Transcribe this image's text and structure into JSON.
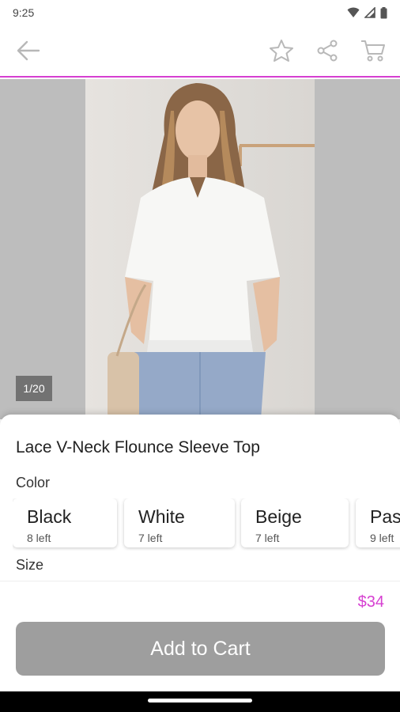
{
  "status_bar": {
    "time": "9:25"
  },
  "gallery": {
    "counter": "1/20"
  },
  "product": {
    "title": "Lace V-Neck Flounce Sleeve Top",
    "color_label": "Color",
    "colors": [
      {
        "name": "Black",
        "stock": "8 left"
      },
      {
        "name": "White",
        "stock": "7 left"
      },
      {
        "name": "Beige",
        "stock": "7 left"
      },
      {
        "name": "Pas",
        "stock": "9 left"
      }
    ],
    "size_label": "Size",
    "price": "$34"
  },
  "actions": {
    "add_to_cart": "Add to Cart"
  },
  "colors": {
    "accent": "#d63fd1",
    "button_bg": "#9e9e9e"
  },
  "icons": [
    "wifi-icon",
    "signal-icon",
    "battery-icon",
    "back-arrow-icon",
    "star-icon",
    "share-icon",
    "cart-icon"
  ]
}
